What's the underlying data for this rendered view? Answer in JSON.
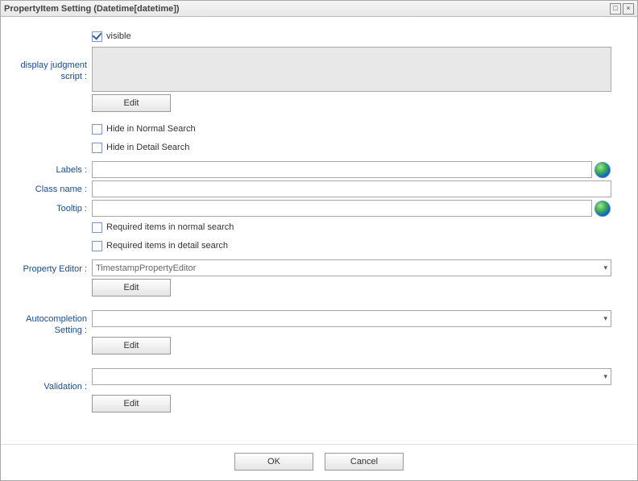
{
  "title": "PropertyItem Setting (Datetime[datetime])",
  "winbtns": {
    "maximize": "□",
    "close": "×"
  },
  "visible": {
    "checked": true,
    "label": "visible"
  },
  "display_judgment_script": {
    "label": "display judgment\nscript :",
    "value": "",
    "edit_label": "Edit"
  },
  "hide_normal_search": {
    "checked": false,
    "label": "Hide in Normal Search"
  },
  "hide_detail_search": {
    "checked": false,
    "label": "Hide in Detail Search"
  },
  "labels_row": {
    "label": "Labels :",
    "value": ""
  },
  "class_name": {
    "label": "Class name :",
    "value": ""
  },
  "tooltip": {
    "label": "Tooltip :",
    "value": ""
  },
  "required_normal": {
    "checked": false,
    "label": "Required items in normal search"
  },
  "required_detail": {
    "checked": false,
    "label": "Required items in detail search"
  },
  "property_editor": {
    "label": "Property Editor :",
    "value": "TimestampPropertyEditor",
    "edit_label": "Edit"
  },
  "autocompletion": {
    "label": "Autocompletion\nSetting :",
    "value": "",
    "edit_label": "Edit"
  },
  "validation": {
    "label": "Validation :",
    "value": "",
    "edit_label": "Edit"
  },
  "footer": {
    "ok": "OK",
    "cancel": "Cancel"
  }
}
